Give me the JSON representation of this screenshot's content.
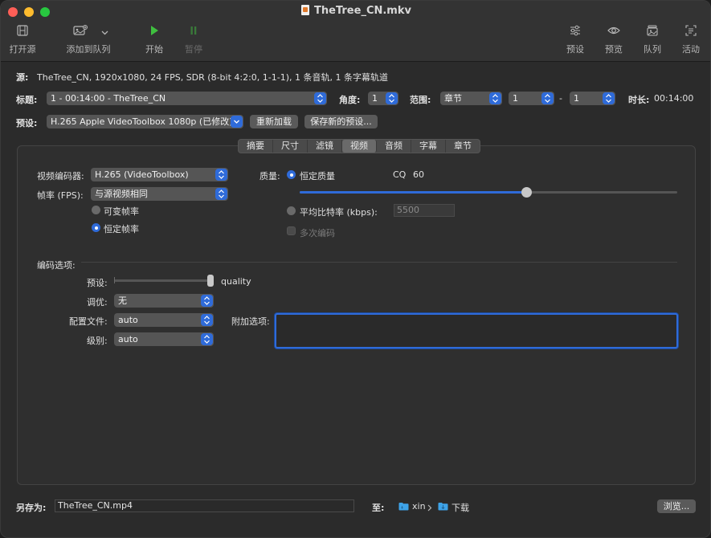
{
  "window": {
    "title": "TheTree_CN.mkv"
  },
  "toolbar": {
    "open_source": "打开源",
    "add_to_queue": "添加到队列",
    "start": "开始",
    "pause": "暂停",
    "presets": "预设",
    "preview": "预览",
    "queue": "队列",
    "activity": "活动"
  },
  "source": {
    "label": "源:",
    "value": "TheTree_CN, 1920x1080, 24 FPS, SDR (8-bit 4:2:0, 1-1-1), 1 条音轨, 1 条字幕轨道"
  },
  "title_row": {
    "label": "标题:",
    "title_value": "1 - 00:14:00 - TheTree_CN",
    "angle_label": "角度:",
    "angle_value": "1",
    "range_label": "范围:",
    "range_type": "章节",
    "range_start": "1",
    "range_dash": "-",
    "range_end": "1",
    "duration_label": "时长:",
    "duration_value": "00:14:00"
  },
  "preset_row": {
    "label": "预设:",
    "value": "H.265 Apple VideoToolbox 1080p (已修改)",
    "reload_button": "重新加载",
    "save_new_button": "保存新的预设..."
  },
  "tabs": [
    "摘要",
    "尺寸",
    "滤镜",
    "视频",
    "音频",
    "字幕",
    "章节"
  ],
  "active_tab": "视频",
  "video": {
    "encoder_label": "视频编码器:",
    "encoder_value": "H.265 (VideoToolbox)",
    "framerate_label": "帧率 (FPS):",
    "framerate_value": "与源视频相同",
    "variable_fr": "可变帧率",
    "constant_fr": "恒定帧率",
    "quality_label": "质量:",
    "constant_quality": "恒定质量",
    "cq_label": "CQ",
    "cq_value": "60",
    "cq_fraction": 0.6,
    "avg_bitrate": "平均比特率 (kbps):",
    "bitrate_placeholder": "5500",
    "multipass": "多次编码"
  },
  "encoder_options": {
    "section_label": "编码选项:",
    "preset_label": "预设:",
    "preset_value": "quality",
    "tune_label": "调优:",
    "tune_value": "无",
    "profile_label": "配置文件:",
    "profile_value": "auto",
    "level_label": "级别:",
    "level_value": "auto",
    "extra_label": "附加选项:",
    "extra_value": ""
  },
  "save": {
    "label": "另存为:",
    "filename": "TheTree_CN.mp4",
    "to_label": "至:",
    "folder1": "xin",
    "folder2": "下载",
    "browse_button": "浏览..."
  },
  "colors": {
    "accent": "#2f6bd9",
    "start_green": "#3fbf3f"
  }
}
